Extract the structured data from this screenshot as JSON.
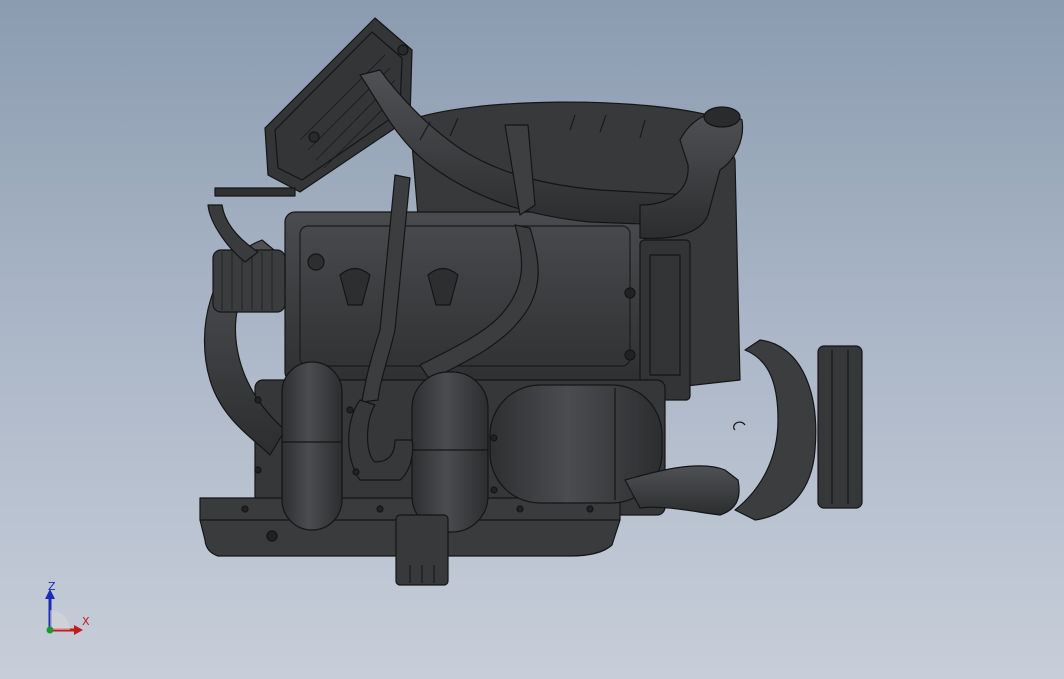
{
  "viewport": {
    "background_top": "#8b9bb0",
    "background_bottom": "#c7ced9",
    "model_color": "#3a3b3d",
    "edge_color": "#141414"
  },
  "model": {
    "icon": "engine-assembly-model"
  },
  "triad": {
    "z_label": "Z",
    "x_label": "X",
    "z_color": "#1a2bb8",
    "x_color": "#c41a1a",
    "y_color": "#1a9a2a"
  }
}
